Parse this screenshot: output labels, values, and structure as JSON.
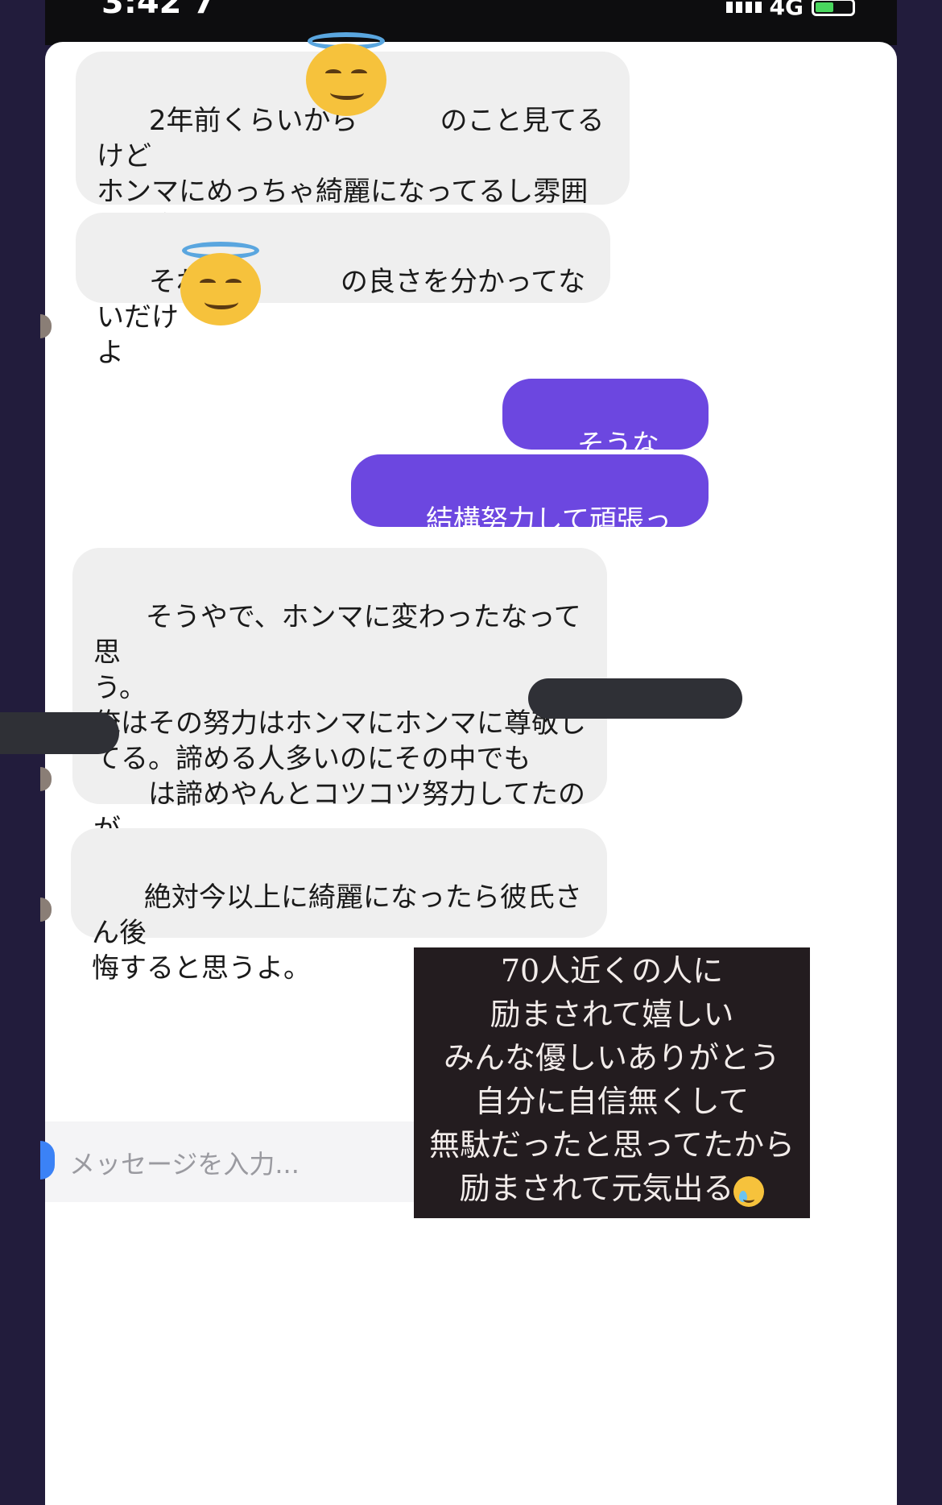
{
  "status_bar": {
    "time": "3:42 7",
    "network": "4G"
  },
  "messages": [
    {
      "id": "m1",
      "direction": "incoming",
      "text": "2年前くらいから　　　のこと見てるけど\nホンマにめっちゃ綺麗になってるし雰囲\n気も変わってるし前よりもっと可愛くな\nってるよ？"
    },
    {
      "id": "m2",
      "direction": "incoming",
      "text": "それは　　　　の良さを分かってないだけ\nよ"
    },
    {
      "id": "m3",
      "direction": "outgoing",
      "text": "そうなんかな"
    },
    {
      "id": "m4",
      "direction": "outgoing",
      "text": "結構努力して頑張った"
    },
    {
      "id": "m5",
      "direction": "incoming",
      "text": "そうやで、ホンマに変わったなって思\nう。\n俺はその努力はホンマにホンマに尊敬し\nてる。諦める人多いのにその中でも\n　　は諦めやんとコツコツ努力してたのが\n伝わってるよ俺には"
    },
    {
      "id": "m6",
      "direction": "incoming",
      "text": "絶対今以上に綺麗になったら彼氏さん後\n悔すると思うよ。"
    }
  ],
  "input": {
    "placeholder": "メッセージを入力..."
  },
  "caption": {
    "lines": [
      "70人近くの人に",
      "励まされて嬉しい",
      "みんな優しいありがとう",
      "自分に自信無くして",
      "無駄だったと思ってたから",
      "励まされて元気出る"
    ]
  },
  "colors": {
    "outgoing_bubble": "#6c47e0",
    "incoming_bubble": "#efefef",
    "background": "#221c3c",
    "caption_bg": "#231c1f"
  },
  "icons": [
    "halo-smile-emoji",
    "tearful-smile-emoji",
    "signal-icon",
    "battery-icon"
  ]
}
